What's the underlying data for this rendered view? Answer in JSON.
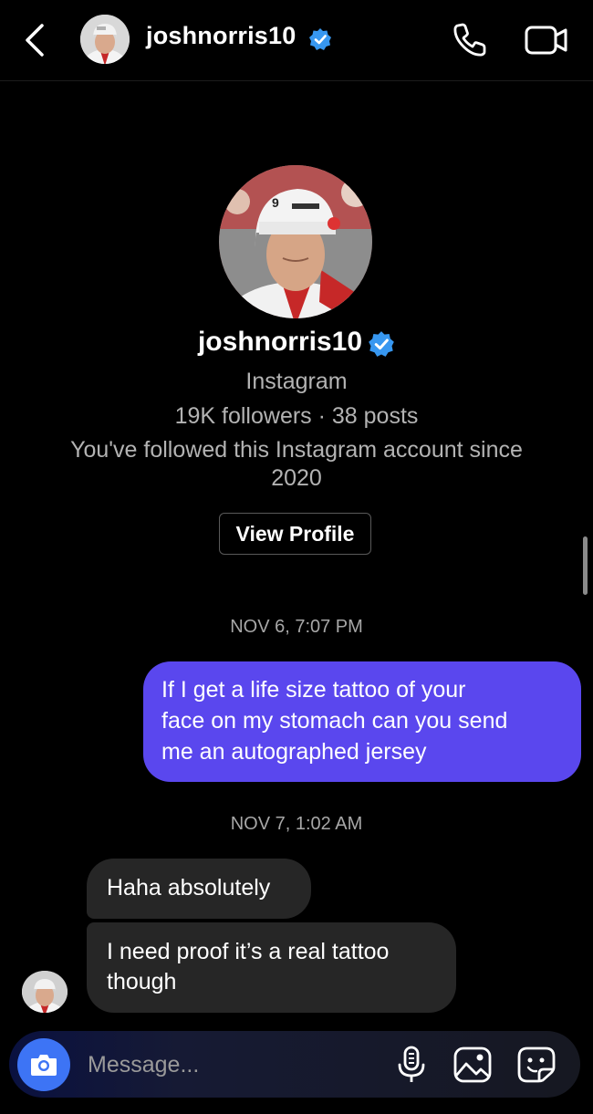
{
  "header": {
    "username": "joshnorris10"
  },
  "profile": {
    "username": "joshnorris10",
    "platform": "Instagram",
    "stats": "19K followers · 38 posts",
    "follow_note_line1": "You've followed this Instagram account since",
    "follow_note_line2": "2020",
    "view_profile_label": "View Profile"
  },
  "conversation": {
    "timestamp_1": "NOV 6, 7:07 PM",
    "sent_message": {
      "line1": "If I get a life size tattoo of your",
      "line2": "face on my stomach can you send",
      "line3": "me an autographed jersey"
    },
    "timestamp_2": "NOV 7, 1:02 AM",
    "received_1": "Haha absolutely",
    "received_2_line1": "I need proof it’s a real tattoo",
    "received_2_line2": "though"
  },
  "composer": {
    "placeholder": "Message..."
  },
  "colors": {
    "accent_bubble": "#5a47ee",
    "camera_button": "#3d74f5",
    "verified_badge": "#3797f0",
    "incoming_bubble": "#262626"
  },
  "icons": [
    "back-arrow-icon",
    "verified-badge-icon",
    "phone-icon",
    "video-camera-icon",
    "camera-icon",
    "microphone-icon",
    "gallery-icon",
    "sticker-icon"
  ]
}
